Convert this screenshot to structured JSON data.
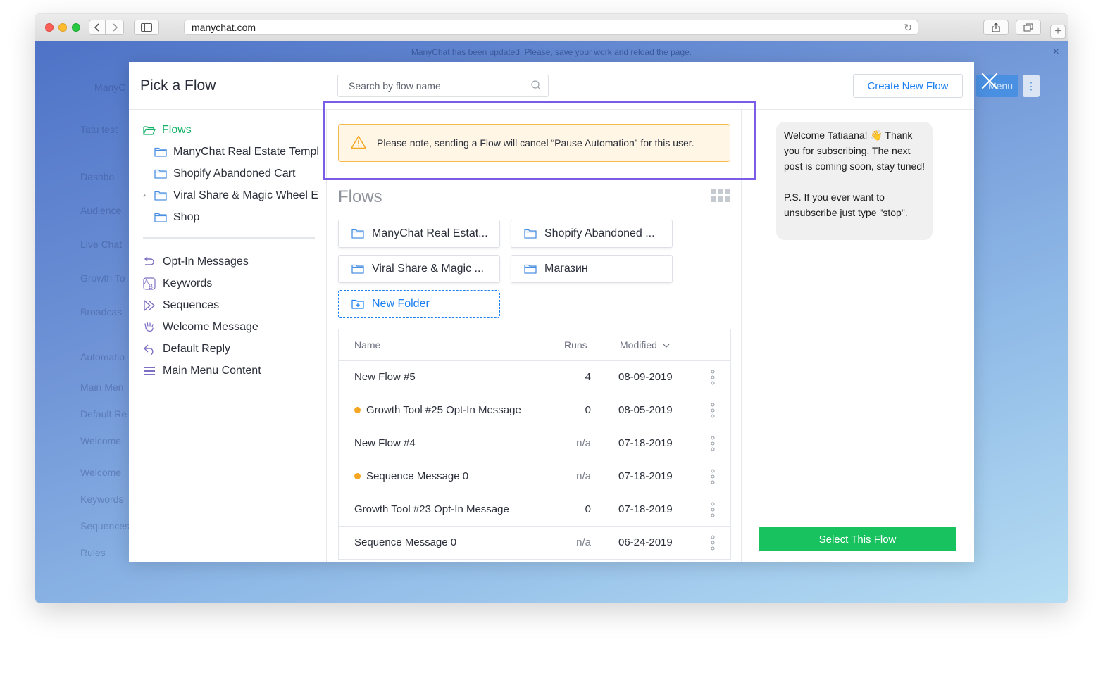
{
  "browser": {
    "url": "manychat.com"
  },
  "banner": {
    "text": "ManyChat has been updated. Please, save your work and reload the page."
  },
  "background_nav": [
    {
      "label": "ManyC"
    },
    {
      "label": "Tatu test"
    },
    {
      "label": "Dashbo"
    },
    {
      "label": "Audience"
    },
    {
      "label": "Live Chat"
    },
    {
      "label": "Growth To"
    },
    {
      "label": "Broadcas"
    },
    {
      "label": "Automatio"
    },
    {
      "label": "Main Men"
    },
    {
      "label": "Default Re"
    },
    {
      "label": "Welcome"
    },
    {
      "label": "Welcome"
    },
    {
      "label": "Keywords"
    },
    {
      "label": "Sequences"
    },
    {
      "label": "Rules"
    }
  ],
  "background_menu_button": "Menu",
  "modal": {
    "title": "Pick a Flow",
    "search_placeholder": "Search by flow name",
    "create_button": "Create New Flow",
    "select_button": "Select This Flow"
  },
  "sidebar": {
    "root": {
      "label": "Flows"
    },
    "folders": [
      {
        "label": "ManyChat Real Estate Templ"
      },
      {
        "label": "Shopify Abandoned Cart"
      },
      {
        "label": "Viral Share & Magic Wheel E"
      },
      {
        "label": "Shop"
      }
    ],
    "nav": [
      {
        "label": "Opt-In Messages",
        "icon": "opt-in-icon"
      },
      {
        "label": "Keywords",
        "icon": "keywords-icon"
      },
      {
        "label": "Sequences",
        "icon": "sequences-icon"
      },
      {
        "label": "Welcome Message",
        "icon": "wave-hand-icon"
      },
      {
        "label": "Default Reply",
        "icon": "reply-icon"
      },
      {
        "label": "Main Menu Content",
        "icon": "menu-icon"
      }
    ]
  },
  "notice": {
    "text": "Please note, sending a Flow will cancel “Pause Automation” for this user."
  },
  "main": {
    "section_title": "Flows",
    "folder_cards": [
      {
        "label": "ManyChat Real Estat..."
      },
      {
        "label": "Shopify Abandoned ..."
      },
      {
        "label": "Viral Share & Magic ..."
      },
      {
        "label": "Магазин"
      }
    ],
    "new_folder_label": "New Folder",
    "table": {
      "headers": {
        "name": "Name",
        "runs": "Runs",
        "modified": "Modified"
      },
      "rows": [
        {
          "name": "New Flow  #5",
          "runs": "4",
          "modified": "08-09-2019",
          "dot": false
        },
        {
          "name": "Growth Tool #25 Opt-In Message",
          "runs": "0",
          "modified": "08-05-2019",
          "dot": true
        },
        {
          "name": "New Flow  #4",
          "runs": "n/a",
          "modified": "07-18-2019",
          "dot": false
        },
        {
          "name": "Sequence Message 0",
          "runs": "n/a",
          "modified": "07-18-2019",
          "dot": true
        },
        {
          "name": "Growth Tool #23 Opt-In Message",
          "runs": "0",
          "modified": "07-18-2019",
          "dot": false
        },
        {
          "name": "Sequence Message 0",
          "runs": "n/a",
          "modified": "06-24-2019",
          "dot": false
        }
      ]
    }
  },
  "preview": {
    "message": "Welcome Tatiaana! 👋 Thank you for subscribing. The next post is coming soon, stay tuned!\n\nP.S. If you ever want to unsubscribe just type \"stop\"."
  },
  "colors": {
    "accent_blue": "#1a7ff0",
    "accent_green": "#18c25f",
    "highlight_purple": "#7b5ce6",
    "warning_orange": "#f5a623",
    "folder_green": "#17b26a"
  }
}
